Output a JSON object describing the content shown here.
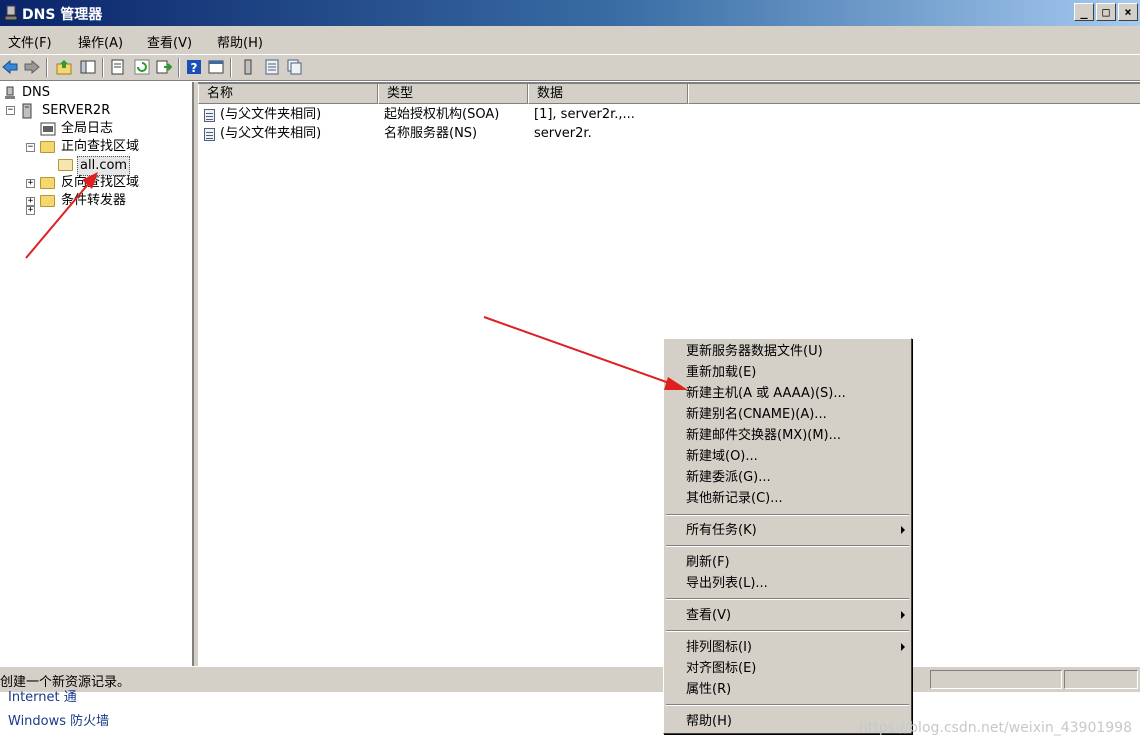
{
  "window": {
    "title": "DNS 管理器"
  },
  "menubar": [
    "文件(F)",
    "操作(A)",
    "查看(V)",
    "帮助(H)"
  ],
  "tree": {
    "root": "DNS",
    "server": "SERVER2R",
    "global_log": "全局日志",
    "forward_zone": "正向查找区域",
    "zone": "all.com",
    "reverse_zone": "反向查找区域",
    "conditional_forwarder": "条件转发器"
  },
  "list": {
    "columns": [
      "名称",
      "类型",
      "数据"
    ],
    "rows": [
      {
        "name": "(与父文件夹相同)",
        "type": "起始授权机构(SOA)",
        "data": "[1], server2r.,..."
      },
      {
        "name": "(与父文件夹相同)",
        "type": "名称服务器(NS)",
        "data": "server2r."
      }
    ]
  },
  "status": {
    "text": "创建一个新资源记录。"
  },
  "behind_window": {
    "line1": "Internet 通",
    "line2": "Windows 防火墙"
  },
  "context_menu": {
    "group1": [
      "更新服务器数据文件(U)",
      "重新加载(E)",
      "新建主机(A 或 AAAA)(S)...",
      "新建别名(CNAME)(A)...",
      "新建邮件交换器(MX)(M)...",
      "新建域(O)...",
      "新建委派(G)...",
      "其他新记录(C)..."
    ],
    "all_tasks": "所有任务(K)",
    "group3": [
      "刷新(F)",
      "导出列表(L)..."
    ],
    "view": "查看(V)",
    "group5": [
      "排列图标(I)",
      "对齐图标(E)",
      "属性(R)"
    ],
    "help": "帮助(H)"
  },
  "watermark": "https://blog.csdn.net/weixin_43901998",
  "colors": {
    "titlebar_start": "#0a246a",
    "arrow": "#e02020",
    "chrome": "#d4d0c8"
  }
}
